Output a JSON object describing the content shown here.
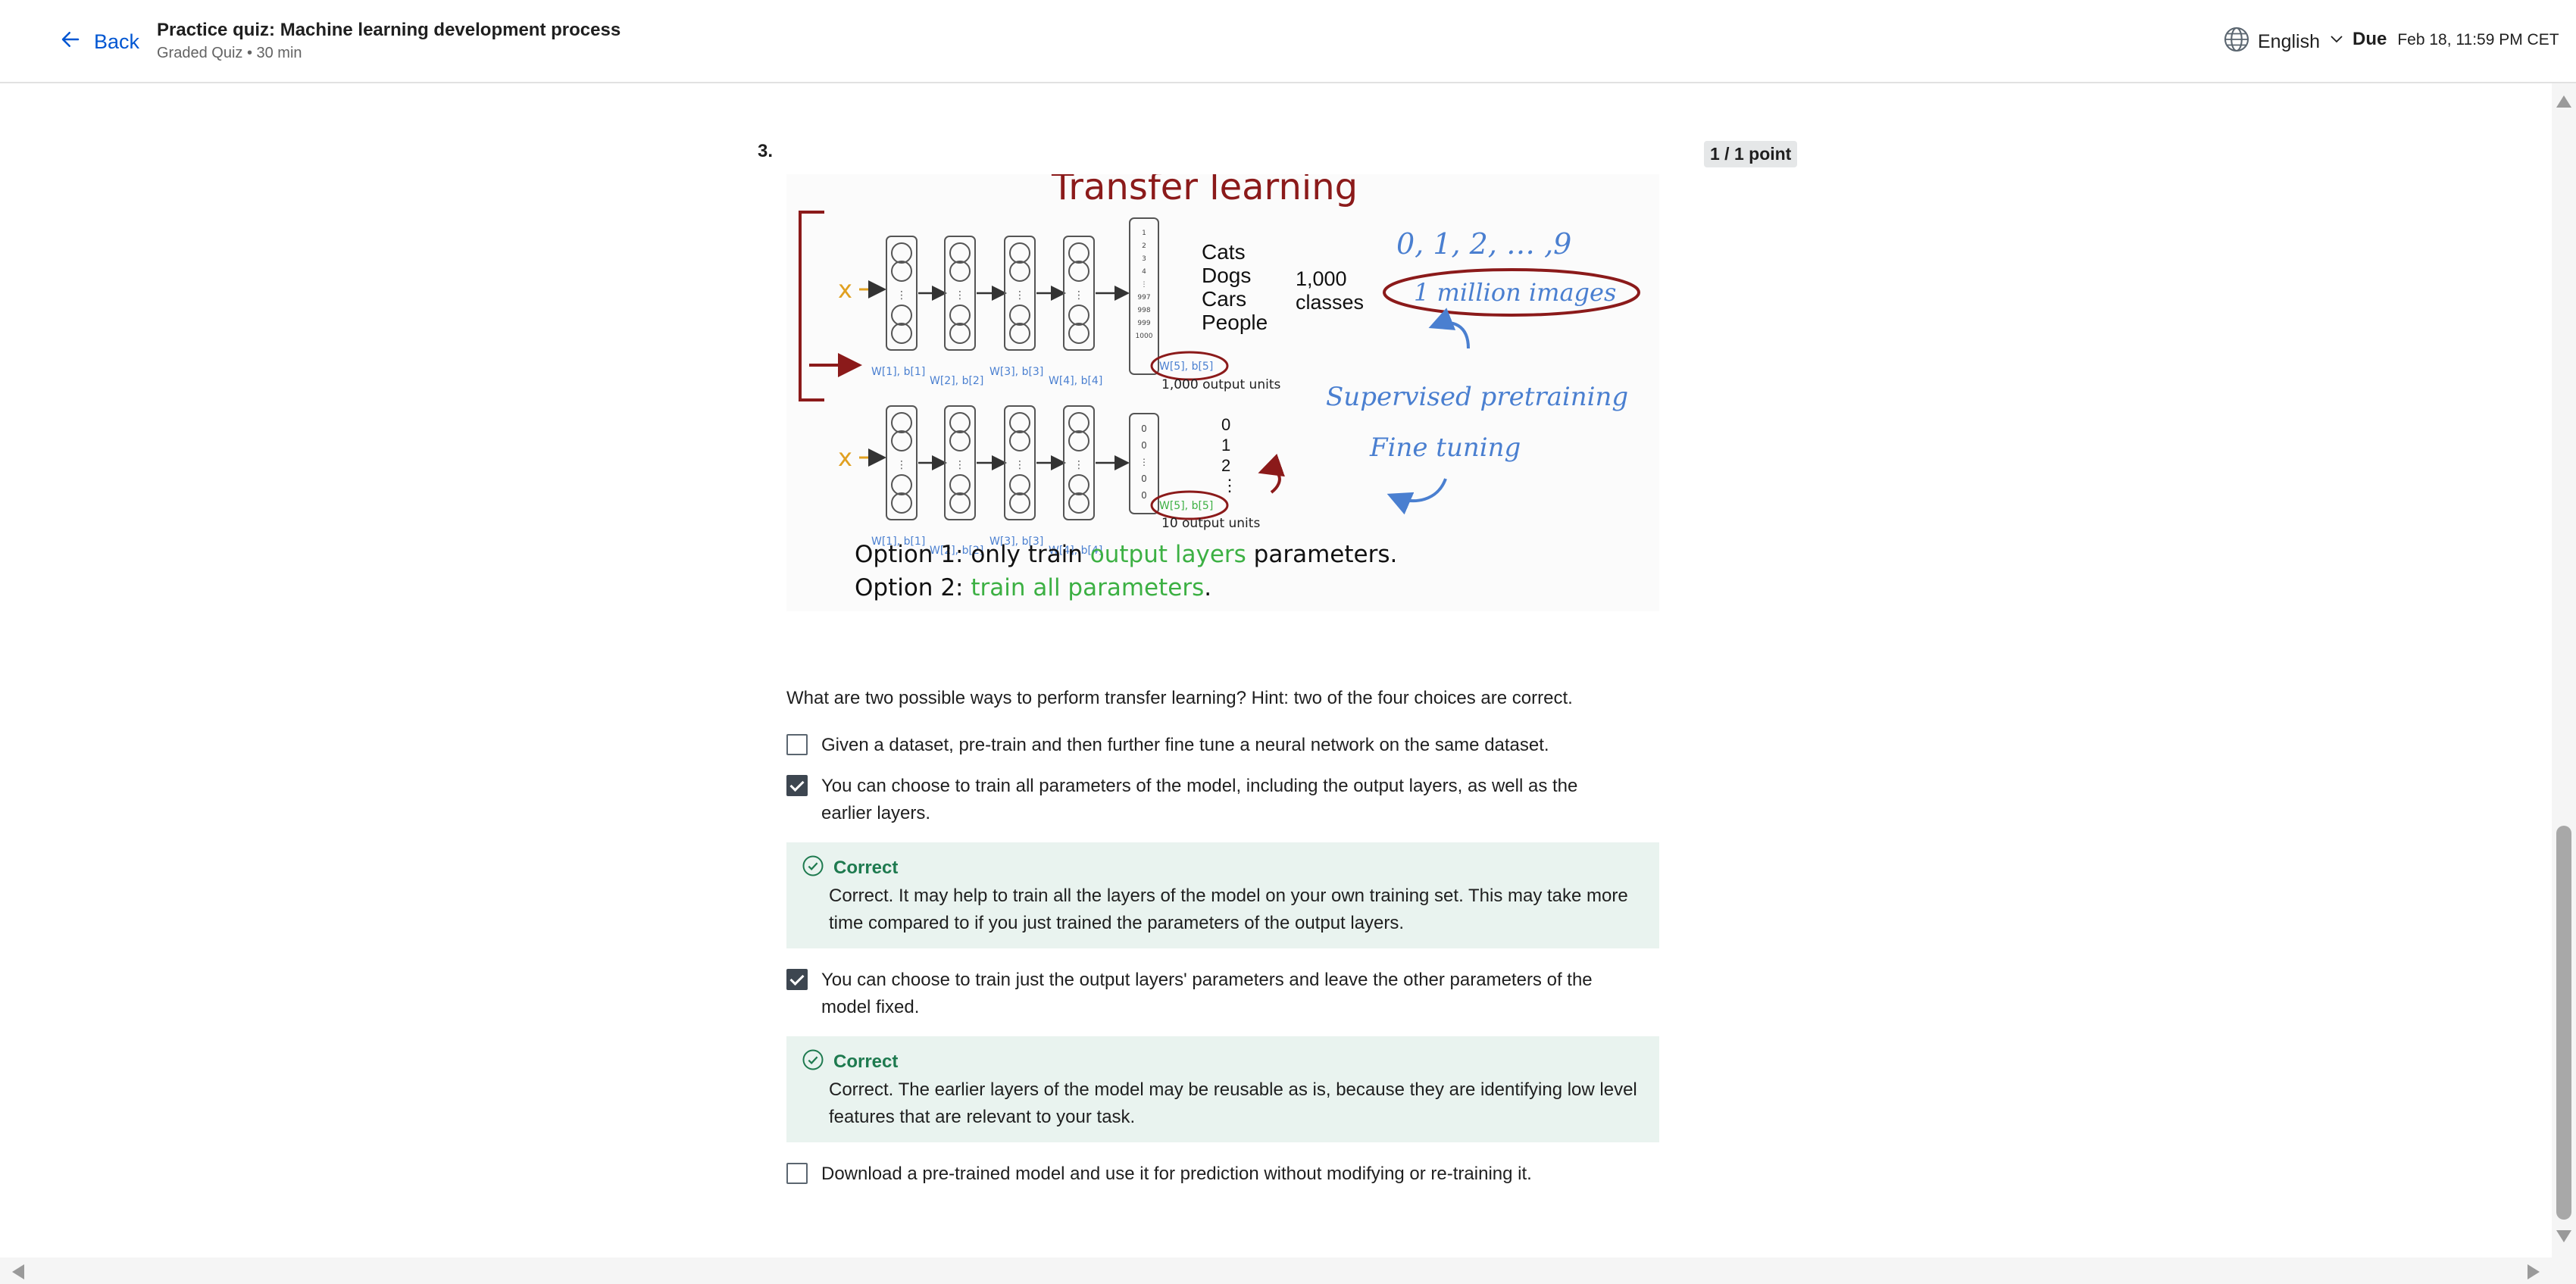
{
  "header": {
    "back_label": "Back",
    "quiz_title": "Practice quiz: Machine learning development process",
    "quiz_subtitle": "Graded Quiz • 30 min",
    "language": "English",
    "due_label": "Due",
    "due_date": "Feb 18, 11:59 PM CET"
  },
  "question": {
    "number": "3.",
    "points": "1 / 1 point",
    "figure": {
      "title": "Transfer learning",
      "classes": [
        "Cats",
        "Dogs",
        "Cars",
        "People"
      ],
      "classes_count": "1,000",
      "classes_word": "classes",
      "digits": "0, 1, 2, … ,9",
      "million_images": "1 million images",
      "supervised_pretraining": "Supervised pretraining",
      "fine_tuning": "Fine tuning",
      "output_units_1000": "1,000 output units",
      "output_units_10": "10 output units",
      "digit_list": [
        "0",
        "1",
        "2",
        "⋮"
      ],
      "top_output_numbers": [
        "1",
        "2",
        "3",
        "4",
        "⋮",
        "997",
        "998",
        "999",
        "1000"
      ],
      "bottom_output_numbers": [
        "0",
        "0",
        "⋮",
        "0",
        "0"
      ],
      "param_labels": [
        "W[1], b[1]",
        "W[2], b[2]",
        "W[3], b[3]",
        "W[4], b[4]",
        "W[5], b[5]"
      ],
      "input_label": "x",
      "option1_prefix": "Option 1: only train ",
      "option1_highlight": "output layers",
      "option1_suffix": " parameters.",
      "option2_prefix": "Option 2: ",
      "option2_highlight": "train all parameters",
      "option2_suffix": "."
    },
    "prompt": "What are two possible ways to perform transfer learning? Hint: two of the four choices are correct.",
    "options": [
      {
        "text": "Given a dataset, pre-train and then further fine tune a neural network on the same dataset.",
        "checked": false
      },
      {
        "text": "You can choose to train all parameters of the model, including the output layers, as well as the earlier layers.",
        "checked": true,
        "feedback_title": "Correct",
        "feedback_text": "Correct. It may help to train all the layers of the model on your own training set. This may take more time compared to if you just trained the parameters of the output layers."
      },
      {
        "text": "You can choose to train just the output layers' parameters and leave the other parameters of the model fixed.",
        "checked": true,
        "feedback_title": "Correct",
        "feedback_text": "Correct. The earlier layers of the model may be reusable as is, because they are identifying low level features that are relevant to your task."
      },
      {
        "text": "Download a pre-trained model and use it for prediction without modifying or re-training it.",
        "checked": false
      }
    ]
  },
  "colors": {
    "link_blue": "#0056d2",
    "correct_green": "#1e7a4f",
    "feedback_bg": "#e9f3ef",
    "figure_red": "#8b1a1a",
    "figure_blue": "#4a7fd0",
    "figure_green": "#3cb043",
    "figure_orange": "#e0a020"
  }
}
